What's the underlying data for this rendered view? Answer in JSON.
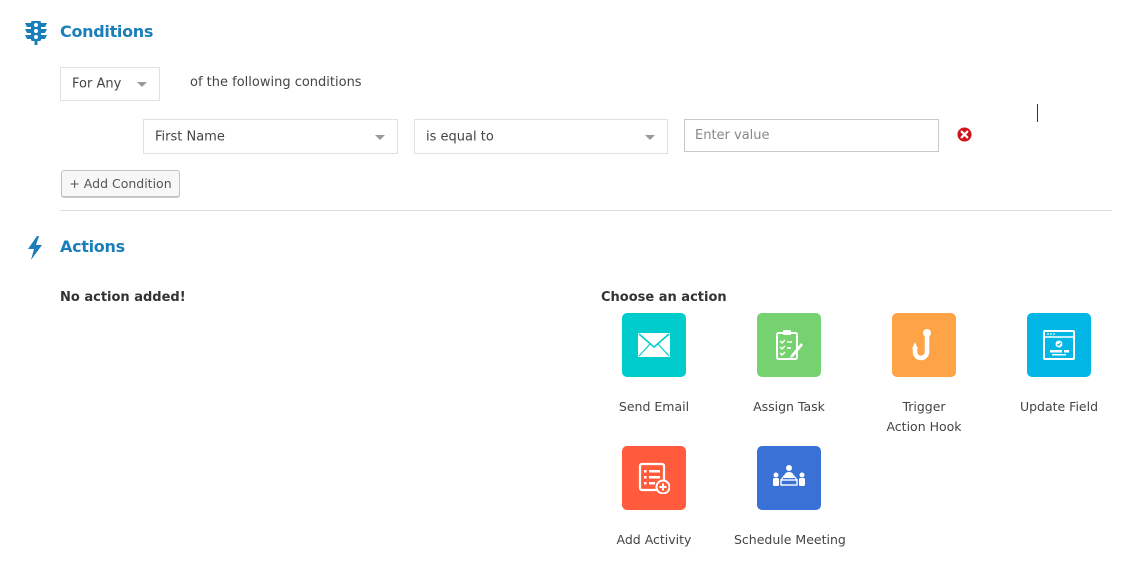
{
  "conditions": {
    "title": "Conditions",
    "match_select": {
      "value": "For Any"
    },
    "match_suffix": "of the following conditions",
    "rows": [
      {
        "field": "First Name",
        "operator": "is equal to",
        "value": "",
        "value_placeholder": "Enter value"
      }
    ],
    "add_button_label": "+ Add Condition"
  },
  "actions": {
    "title": "Actions",
    "empty_message": "No action added!",
    "choose_label": "Choose an action",
    "items": [
      {
        "label": "Send Email",
        "icon": "envelope-icon",
        "color": "#00cccc"
      },
      {
        "label": "Assign Task",
        "icon": "clipboard-task-icon",
        "color": "#76d170"
      },
      {
        "label": "Trigger Action Hook",
        "icon": "hook-icon",
        "color": "#ffa347"
      },
      {
        "label": "Update Field",
        "icon": "update-field-icon",
        "color": "#02b6e6"
      },
      {
        "label": "Add Activity",
        "icon": "add-activity-icon",
        "color": "#ff5b3c"
      },
      {
        "label": "Schedule Meeting",
        "icon": "meeting-icon",
        "color": "#3a71d6"
      }
    ]
  },
  "colors": {
    "accent": "#1a7fb9",
    "remove_icon": "#d0121b"
  }
}
